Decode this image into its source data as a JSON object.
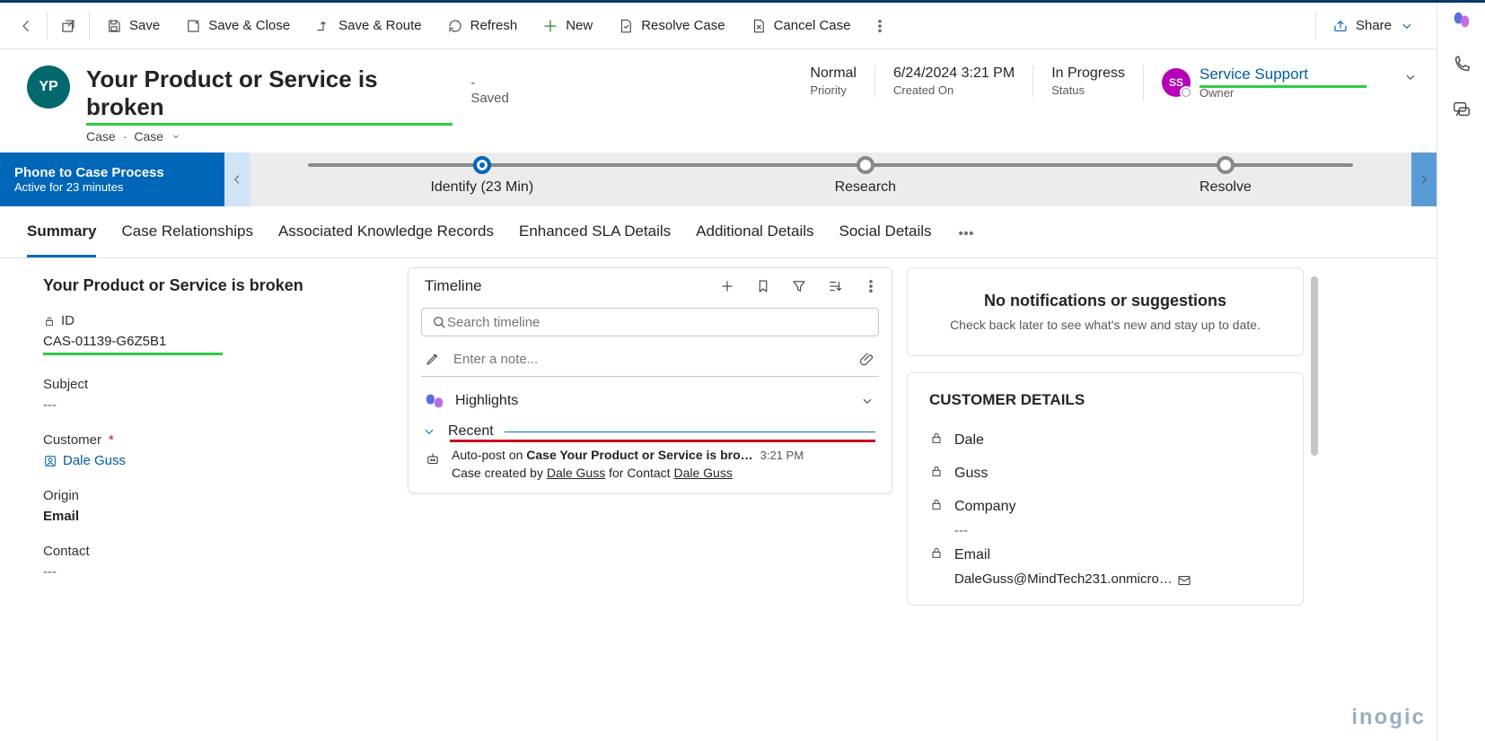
{
  "toolbar": {
    "save": "Save",
    "save_close": "Save & Close",
    "save_route": "Save & Route",
    "refresh": "Refresh",
    "new": "New",
    "resolve": "Resolve Case",
    "cancel": "Cancel Case",
    "share": "Share"
  },
  "header": {
    "avatar_initials": "YP",
    "title": "Your Product or Service is broken",
    "saved_suffix": "- Saved",
    "entity_left": "Case",
    "entity_right": "Case",
    "priority": {
      "value": "Normal",
      "label": "Priority"
    },
    "created_on": {
      "value": "6/24/2024 3:21 PM",
      "label": "Created On"
    },
    "status": {
      "value": "In Progress",
      "label": "Status"
    },
    "owner": {
      "value": "Service Support",
      "label": "Owner",
      "initials": "SS"
    }
  },
  "bpf": {
    "name": "Phone to Case Process",
    "status": "Active for 23 minutes",
    "stage1": "Identify  (23 Min)",
    "stage2": "Research",
    "stage3": "Resolve"
  },
  "tabs": {
    "summary": "Summary",
    "rel": "Case Relationships",
    "kb": "Associated Knowledge Records",
    "sla": "Enhanced SLA Details",
    "add": "Additional Details",
    "social": "Social Details"
  },
  "summary": {
    "case_title": "Your Product or Service is broken",
    "id_label": "ID",
    "id_value": "CAS-01139-G6Z5B1",
    "subject_label": "Subject",
    "subject_value": "---",
    "customer_label": "Customer",
    "customer_value": "Dale Guss",
    "origin_label": "Origin",
    "origin_value": "Email",
    "contact_label": "Contact",
    "contact_value": "---"
  },
  "timeline": {
    "title": "Timeline",
    "search_ph": "Search timeline",
    "note_ph": "Enter a note...",
    "highlights": "Highlights",
    "recent": "Recent",
    "item_pre": "Auto-post on ",
    "item_bold": "Case Your Product or Service is bro…",
    "item_time": "3:21 PM",
    "item_sub_pre": "Case created by ",
    "item_sub_link1": "Dale Guss",
    "item_sub_mid": " for Contact ",
    "item_sub_link2": "Dale Guss"
  },
  "notifications": {
    "title": "No notifications or suggestions",
    "body": "Check back later to see what's new and stay up to date."
  },
  "customer_details": {
    "heading": "CUSTOMER DETAILS",
    "first": "Dale",
    "last": "Guss",
    "company_label": "Company",
    "company_value": "---",
    "email_label": "Email",
    "email_value": "DaleGuss@MindTech231.onmicro…"
  },
  "watermark": "inogic"
}
